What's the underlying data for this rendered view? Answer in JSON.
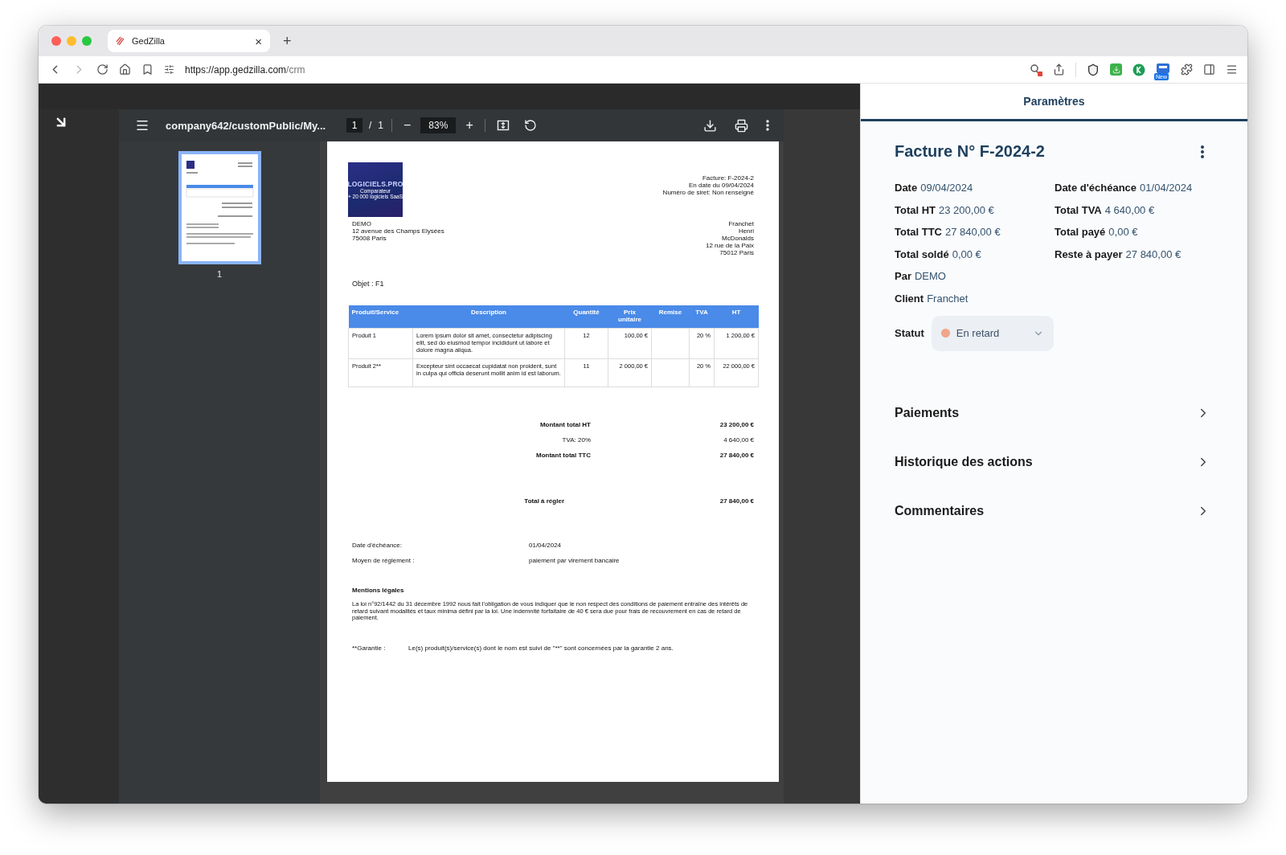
{
  "browser": {
    "tab_title": "GedZilla",
    "tab_close": "×",
    "new_tab": "+",
    "url_host": "https://app.gedzilla.com",
    "url_path": "/crm",
    "extension_badge": "New"
  },
  "pdf_viewer": {
    "filename": "company642/customPublic/My...",
    "page_input": "1",
    "page_separator": "/",
    "page_total": "1",
    "zoom_out": "−",
    "zoom": "83%",
    "zoom_in": "+",
    "thumbnails": [
      {
        "label": "1",
        "selected": true
      }
    ]
  },
  "invoice": {
    "logo": {
      "name": "LOGICIELS.PRO",
      "tagline": [
        "Comparateur",
        "+ 20 000 logiciels SaaS"
      ]
    },
    "header": [
      "Facture: F-2024-2",
      "En date du 09/04/2024",
      "Numéro de siret: Non renseigné"
    ],
    "seller": [
      "DEMO",
      "12 avenue des Champs Elysées",
      "75008 Paris"
    ],
    "client": [
      "Franchet",
      "Henri",
      "McDonalds",
      "12 rue de la Paix",
      "75012 Paris"
    ],
    "subject": "Objet : F1",
    "columns": [
      "Produit/Service",
      "Description",
      "Quantité",
      "Prix unitaire",
      "Remise",
      "TVA",
      "HT"
    ],
    "rows": [
      {
        "product": "Produit 1",
        "description": "Lorem ipsum dolor sit amet, consectetur adipiscing elit, sed do eiusmod tempor incididunt ut labore et dolore magna aliqua.",
        "quantity": "12",
        "unit_price": "100,00 €",
        "tva": "20 %",
        "ht": "1 200,00 €"
      },
      {
        "product": "Produit 2**",
        "description": "Excepteur sint occaecat cupidatat non proident, sunt in culpa qui officia deserunt mollit anim id est laborum.",
        "quantity": "11",
        "unit_price": "2 000,00 €",
        "tva": "20 %",
        "ht": "22 000,00 €"
      }
    ],
    "totals": [
      {
        "label": "Montant total HT",
        "value": "23 200,00 €",
        "bold": true
      },
      {
        "label": "TVA: 20%",
        "value": "4 640,00 €",
        "bold": false
      },
      {
        "label": "Montant total TTC",
        "value": "27 840,00 €",
        "bold": true
      }
    ],
    "total_due": {
      "label": "Total à régler",
      "value": "27 840,00 €"
    },
    "terms": [
      {
        "label": "Date d'échéance:",
        "value": "01/04/2024"
      },
      {
        "label": "Moyen de réglement :",
        "value": "paiement par virement bancaire"
      }
    ],
    "legal_title": "Mentions légales",
    "legal_text": "La loi n°92/1442 du 31 décembre 1992 nous fait l'obligation de vous indiquer que le non respect des conditions de paiement entraîne des intérêts de retard suivant modalités et taux minima défini par la loi. Une indemnité forfaitaire de 40 € sera due pour frais de recouvrement en cas de retard de paiement.",
    "guarantee": {
      "label": "**Garantie :",
      "value": "Le(s) produit(s)/service(s) dont le nom est suivi de \"**\" sont concernées par la garantie 2 ans."
    }
  },
  "panel": {
    "tab": {
      "label": "Paramètres",
      "selected": true
    },
    "title": "Facture N° F-2024-2",
    "summary": [
      {
        "label": "Date",
        "value": "09/04/2024"
      },
      {
        "label": "Date d'échéance",
        "value": "01/04/2024"
      },
      {
        "label": "Total HT",
        "value": "23 200,00 €"
      },
      {
        "label": "Total TVA",
        "value": "4 640,00 €"
      },
      {
        "label": "Total TTC",
        "value": "27 840,00 €"
      },
      {
        "label": "Total payé",
        "value": "0,00 €"
      },
      {
        "label": "Total soldé",
        "value": "0,00 €"
      },
      {
        "label": "Reste à payer",
        "value": "27 840,00 €"
      }
    ],
    "details": [
      {
        "label": "Par",
        "value": "DEMO"
      },
      {
        "label": "Client",
        "value": "Franchet"
      }
    ],
    "status": {
      "label": "Statut",
      "value": "En retard",
      "color": "#f0a58a"
    },
    "sections": [
      {
        "title": "Paiements",
        "expanded": false
      },
      {
        "title": "Historique des actions",
        "expanded": false
      },
      {
        "title": "Commentaires",
        "expanded": false
      }
    ]
  }
}
